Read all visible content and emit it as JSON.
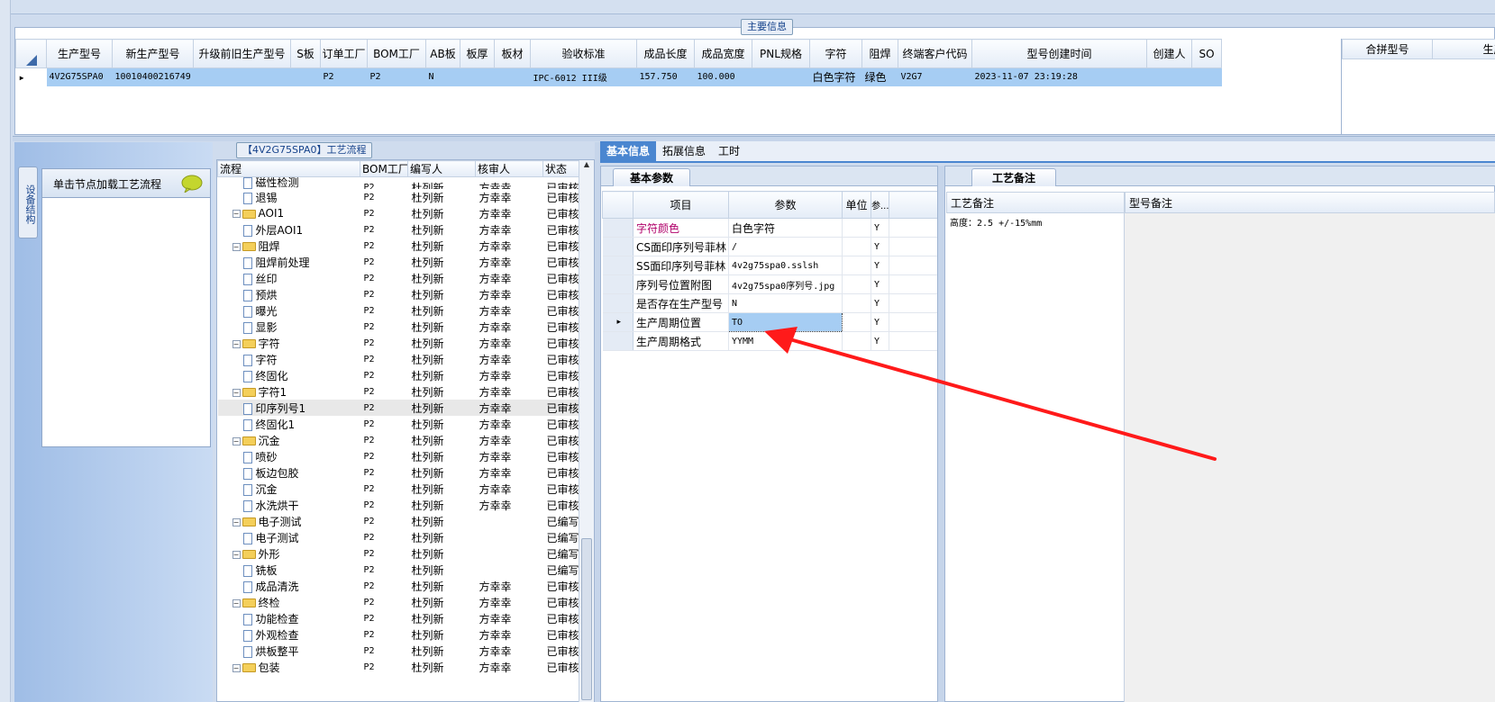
{
  "main_info": {
    "caption": "主要信息",
    "columns": [
      "生产型号",
      "新生产型号",
      "升级前旧生产型号",
      "S板",
      "订单工厂",
      "BOM工厂",
      "AB板",
      "板厚",
      "板材",
      "验收标准",
      "成品长度",
      "成品宽度",
      "PNL规格",
      "字符",
      "阻焊",
      "终端客户代码",
      "型号创建时间",
      "创建人",
      "SO"
    ],
    "row": [
      "4V2G75SPA0",
      "10010400216749",
      "",
      "",
      "P2",
      "P2",
      "N",
      "",
      "",
      "IPC-6012 III级",
      "157.750",
      "100.000",
      "",
      "白色字符",
      "绿色",
      "V2G7",
      "2023-11-07 23:19:28",
      "",
      ""
    ],
    "right_columns": [
      "合拼型号",
      "生产型号"
    ]
  },
  "side_panel": {
    "vertical_tab": "设备结构",
    "node_hint": "单击节点加载工艺流程"
  },
  "process": {
    "caption": "【4V2G75SPA0】工艺流程",
    "columns": [
      "流程",
      "BOM工厂",
      "编写人",
      "核审人",
      "状态"
    ],
    "rows": [
      {
        "name": "磁性检测",
        "type": "doc",
        "indent": 1,
        "factory": "P2",
        "writer": "杜列新",
        "reviewer": "方幸幸",
        "status": "已审核"
      },
      {
        "name": "退锡",
        "type": "doc",
        "indent": 1,
        "factory": "P2",
        "writer": "杜列新",
        "reviewer": "方幸幸",
        "status": "已审核"
      },
      {
        "name": "AOI1",
        "type": "folder",
        "indent": 0,
        "factory": "P2",
        "writer": "杜列新",
        "reviewer": "方幸幸",
        "status": "已审核"
      },
      {
        "name": "外层AOI1",
        "type": "doc",
        "indent": 1,
        "factory": "P2",
        "writer": "杜列新",
        "reviewer": "方幸幸",
        "status": "已审核"
      },
      {
        "name": "阻焊",
        "type": "folder",
        "indent": 0,
        "factory": "P2",
        "writer": "杜列新",
        "reviewer": "方幸幸",
        "status": "已审核"
      },
      {
        "name": "阻焊前处理",
        "type": "doc",
        "indent": 1,
        "factory": "P2",
        "writer": "杜列新",
        "reviewer": "方幸幸",
        "status": "已审核"
      },
      {
        "name": "丝印",
        "type": "doc",
        "indent": 1,
        "factory": "P2",
        "writer": "杜列新",
        "reviewer": "方幸幸",
        "status": "已审核"
      },
      {
        "name": "预烘",
        "type": "doc",
        "indent": 1,
        "factory": "P2",
        "writer": "杜列新",
        "reviewer": "方幸幸",
        "status": "已审核"
      },
      {
        "name": "曝光",
        "type": "doc",
        "indent": 1,
        "factory": "P2",
        "writer": "杜列新",
        "reviewer": "方幸幸",
        "status": "已审核"
      },
      {
        "name": "显影",
        "type": "doc",
        "indent": 1,
        "factory": "P2",
        "writer": "杜列新",
        "reviewer": "方幸幸",
        "status": "已审核"
      },
      {
        "name": "字符",
        "type": "folder",
        "indent": 0,
        "factory": "P2",
        "writer": "杜列新",
        "reviewer": "方幸幸",
        "status": "已审核"
      },
      {
        "name": "字符",
        "type": "doc",
        "indent": 1,
        "factory": "P2",
        "writer": "杜列新",
        "reviewer": "方幸幸",
        "status": "已审核"
      },
      {
        "name": "终固化",
        "type": "doc",
        "indent": 1,
        "factory": "P2",
        "writer": "杜列新",
        "reviewer": "方幸幸",
        "status": "已审核"
      },
      {
        "name": "字符1",
        "type": "folder",
        "indent": 0,
        "factory": "P2",
        "writer": "杜列新",
        "reviewer": "方幸幸",
        "status": "已审核"
      },
      {
        "name": "印序列号1",
        "type": "doc",
        "indent": 1,
        "factory": "P2",
        "writer": "杜列新",
        "reviewer": "方幸幸",
        "status": "已审核",
        "selected": true
      },
      {
        "name": "终固化1",
        "type": "doc",
        "indent": 1,
        "factory": "P2",
        "writer": "杜列新",
        "reviewer": "方幸幸",
        "status": "已审核"
      },
      {
        "name": "沉金",
        "type": "folder",
        "indent": 0,
        "factory": "P2",
        "writer": "杜列新",
        "reviewer": "方幸幸",
        "status": "已审核"
      },
      {
        "name": "喷砂",
        "type": "doc",
        "indent": 1,
        "factory": "P2",
        "writer": "杜列新",
        "reviewer": "方幸幸",
        "status": "已审核"
      },
      {
        "name": "板边包胶",
        "type": "doc",
        "indent": 1,
        "factory": "P2",
        "writer": "杜列新",
        "reviewer": "方幸幸",
        "status": "已审核"
      },
      {
        "name": "沉金",
        "type": "doc",
        "indent": 1,
        "factory": "P2",
        "writer": "杜列新",
        "reviewer": "方幸幸",
        "status": "已审核"
      },
      {
        "name": "水洗烘干",
        "type": "doc",
        "indent": 1,
        "factory": "P2",
        "writer": "杜列新",
        "reviewer": "方幸幸",
        "status": "已审核"
      },
      {
        "name": "电子测试",
        "type": "folder",
        "indent": 0,
        "factory": "P2",
        "writer": "杜列新",
        "reviewer": "",
        "status": "已编写"
      },
      {
        "name": "电子测试",
        "type": "doc",
        "indent": 1,
        "factory": "P2",
        "writer": "杜列新",
        "reviewer": "",
        "status": "已编写"
      },
      {
        "name": "外形",
        "type": "folder",
        "indent": 0,
        "factory": "P2",
        "writer": "杜列新",
        "reviewer": "",
        "status": "已编写"
      },
      {
        "name": "铣板",
        "type": "doc",
        "indent": 1,
        "factory": "P2",
        "writer": "杜列新",
        "reviewer": "",
        "status": "已编写"
      },
      {
        "name": "成品清洗",
        "type": "doc",
        "indent": 1,
        "factory": "P2",
        "writer": "杜列新",
        "reviewer": "方幸幸",
        "status": "已审核"
      },
      {
        "name": "终检",
        "type": "folder",
        "indent": 0,
        "factory": "P2",
        "writer": "杜列新",
        "reviewer": "方幸幸",
        "status": "已审核"
      },
      {
        "name": "功能检查",
        "type": "doc",
        "indent": 1,
        "factory": "P2",
        "writer": "杜列新",
        "reviewer": "方幸幸",
        "status": "已审核"
      },
      {
        "name": "外观检查",
        "type": "doc",
        "indent": 1,
        "factory": "P2",
        "writer": "杜列新",
        "reviewer": "方幸幸",
        "status": "已审核"
      },
      {
        "name": "烘板整平",
        "type": "doc",
        "indent": 1,
        "factory": "P2",
        "writer": "杜列新",
        "reviewer": "方幸幸",
        "status": "已审核"
      },
      {
        "name": "包装",
        "type": "folder",
        "indent": 0,
        "factory": "P2",
        "writer": "杜列新",
        "reviewer": "方幸幸",
        "status": "已审核"
      }
    ]
  },
  "tabs": [
    "基本信息",
    "拓展信息",
    "工时"
  ],
  "basic_params": {
    "caption": "基本参数",
    "columns": [
      "项目",
      "参数",
      "单位",
      "参..."
    ],
    "rows": [
      {
        "item": "字符颜色",
        "value": "白色字符",
        "unit": "",
        "flag": "Y",
        "highlight": true
      },
      {
        "item": "CS面印序列号菲林",
        "value": "/",
        "unit": "",
        "flag": "Y"
      },
      {
        "item": "SS面印序列号菲林",
        "value": "4v2g75spa0.sslsh",
        "unit": "",
        "flag": "Y"
      },
      {
        "item": "序列号位置附图",
        "value": "4v2g75spa0序列号.jpg",
        "unit": "",
        "flag": "Y"
      },
      {
        "item": "是否存在生产型号",
        "value": "N",
        "unit": "",
        "flag": "Y"
      },
      {
        "item": "生产周期位置",
        "value": "TO",
        "unit": "",
        "flag": "Y",
        "selected": true
      },
      {
        "item": "生产周期格式",
        "value": "YYMM",
        "unit": "",
        "flag": "Y"
      }
    ]
  },
  "process_notes": {
    "caption": "工艺备注",
    "col1": "工艺备注",
    "col2": "型号备注",
    "note": "高度：2.5 +/-15%mm"
  },
  "colors": {
    "arrow": "#ff1a1a",
    "selection": "#a6cdf3",
    "highlight_text": "#b0006a"
  }
}
